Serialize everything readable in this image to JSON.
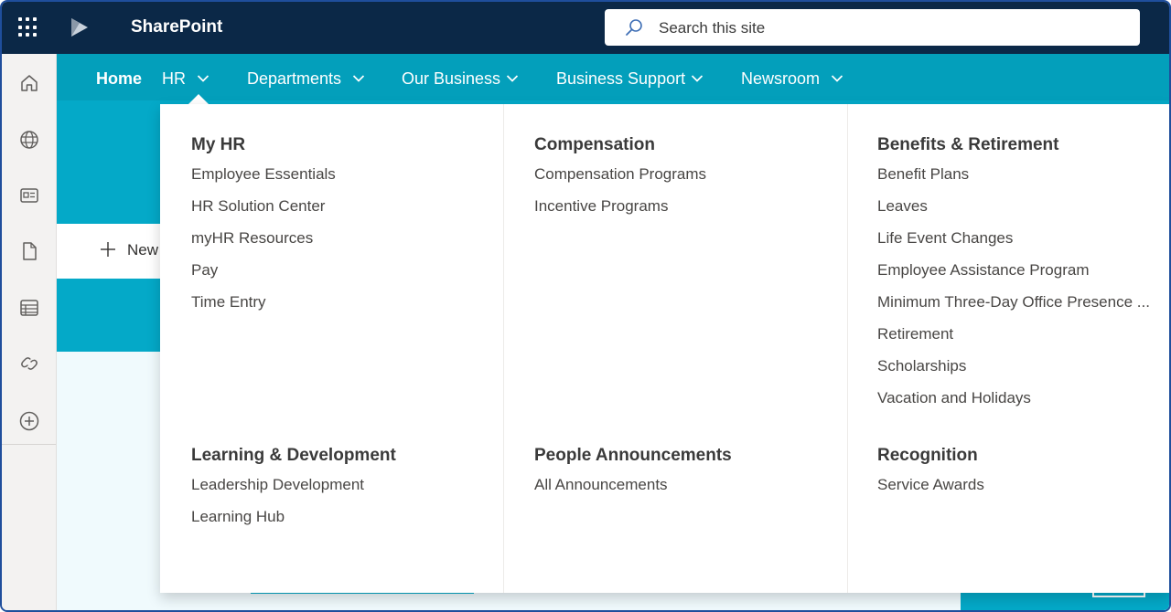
{
  "suite": {
    "app_name": "SharePoint",
    "search_placeholder": "Search this site"
  },
  "hubnav": {
    "items": [
      {
        "label": "Home",
        "has_menu": false
      },
      {
        "label": "HR",
        "has_menu": true
      },
      {
        "label": "Departments",
        "has_menu": true
      },
      {
        "label": "Our Business",
        "has_menu": true
      },
      {
        "label": "Business Support",
        "has_menu": true
      },
      {
        "label": "Newsroom",
        "has_menu": true
      }
    ]
  },
  "appbar": {
    "icons": [
      "home-icon",
      "globe-icon",
      "news-icon",
      "file-icon",
      "list-icon",
      "link-icon",
      "add-icon"
    ]
  },
  "page": {
    "new_button_label": "New"
  },
  "mega_menu": {
    "groups": [
      {
        "heading": "My HR",
        "links": [
          "Employee Essentials",
          "HR Solution Center",
          "myHR Resources",
          "Pay",
          "Time Entry"
        ]
      },
      {
        "heading": "Compensation",
        "links": [
          "Compensation Programs",
          "Incentive Programs"
        ]
      },
      {
        "heading": "Benefits & Retirement",
        "links": [
          "Benefit Plans",
          "Leaves",
          "Life Event Changes",
          "Employee Assistance Program",
          "Minimum Three-Day Office Presence ...",
          "Retirement",
          "Scholarships",
          "Vacation and Holidays"
        ]
      },
      {
        "heading": "Learning & Development",
        "links": [
          "Leadership Development",
          "Learning Hub"
        ]
      },
      {
        "heading": "People Announcements",
        "links": [
          "All Announcements"
        ]
      },
      {
        "heading": "Recognition",
        "links": [
          "Service Awards"
        ]
      }
    ]
  },
  "colors": {
    "suite_bar": "#0b2847",
    "hub_nav": "#039fbb",
    "accent": "#04a9c8"
  }
}
